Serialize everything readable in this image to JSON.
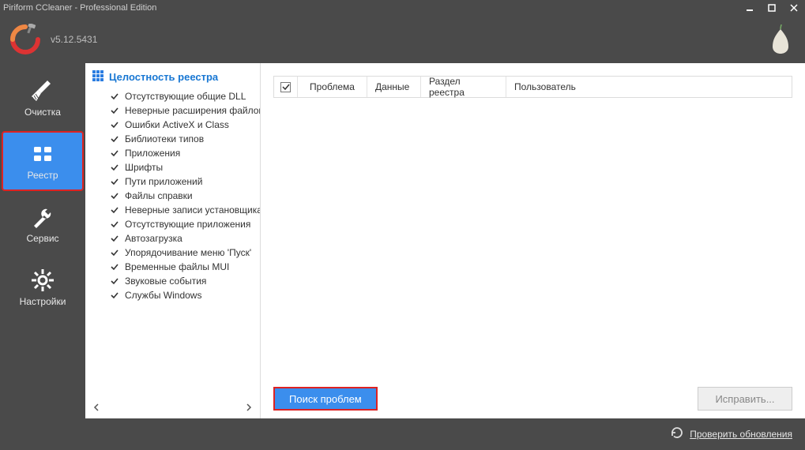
{
  "title": "Piriform CCleaner - Professional Edition",
  "version": "v5.12.5431",
  "sidebar": {
    "items": [
      {
        "label": "Очистка"
      },
      {
        "label": "Реестр"
      },
      {
        "label": "Сервис"
      },
      {
        "label": "Настройки"
      }
    ]
  },
  "checklist": {
    "title": "Целостность реестра",
    "items": [
      {
        "label": "Отсутствующие общие DLL"
      },
      {
        "label": "Неверные расширения файлов"
      },
      {
        "label": "Ошибки ActiveX и Class"
      },
      {
        "label": "Библиотеки типов"
      },
      {
        "label": "Приложения"
      },
      {
        "label": "Шрифты"
      },
      {
        "label": "Пути приложений"
      },
      {
        "label": "Файлы справки"
      },
      {
        "label": "Неверные записи установщика"
      },
      {
        "label": "Отсутствующие приложения"
      },
      {
        "label": "Автозагрузка"
      },
      {
        "label": "Упорядочивание меню 'Пуск'"
      },
      {
        "label": "Временные файлы MUI"
      },
      {
        "label": "Звуковые события"
      },
      {
        "label": "Службы Windows"
      }
    ]
  },
  "table": {
    "columns": {
      "problem": "Проблема",
      "data": "Данные",
      "section": "Раздел реестра",
      "user": "Пользователь"
    }
  },
  "buttons": {
    "scan": "Поиск проблем",
    "fix": "Исправить..."
  },
  "footer": {
    "check_updates": "Проверить обновления"
  }
}
